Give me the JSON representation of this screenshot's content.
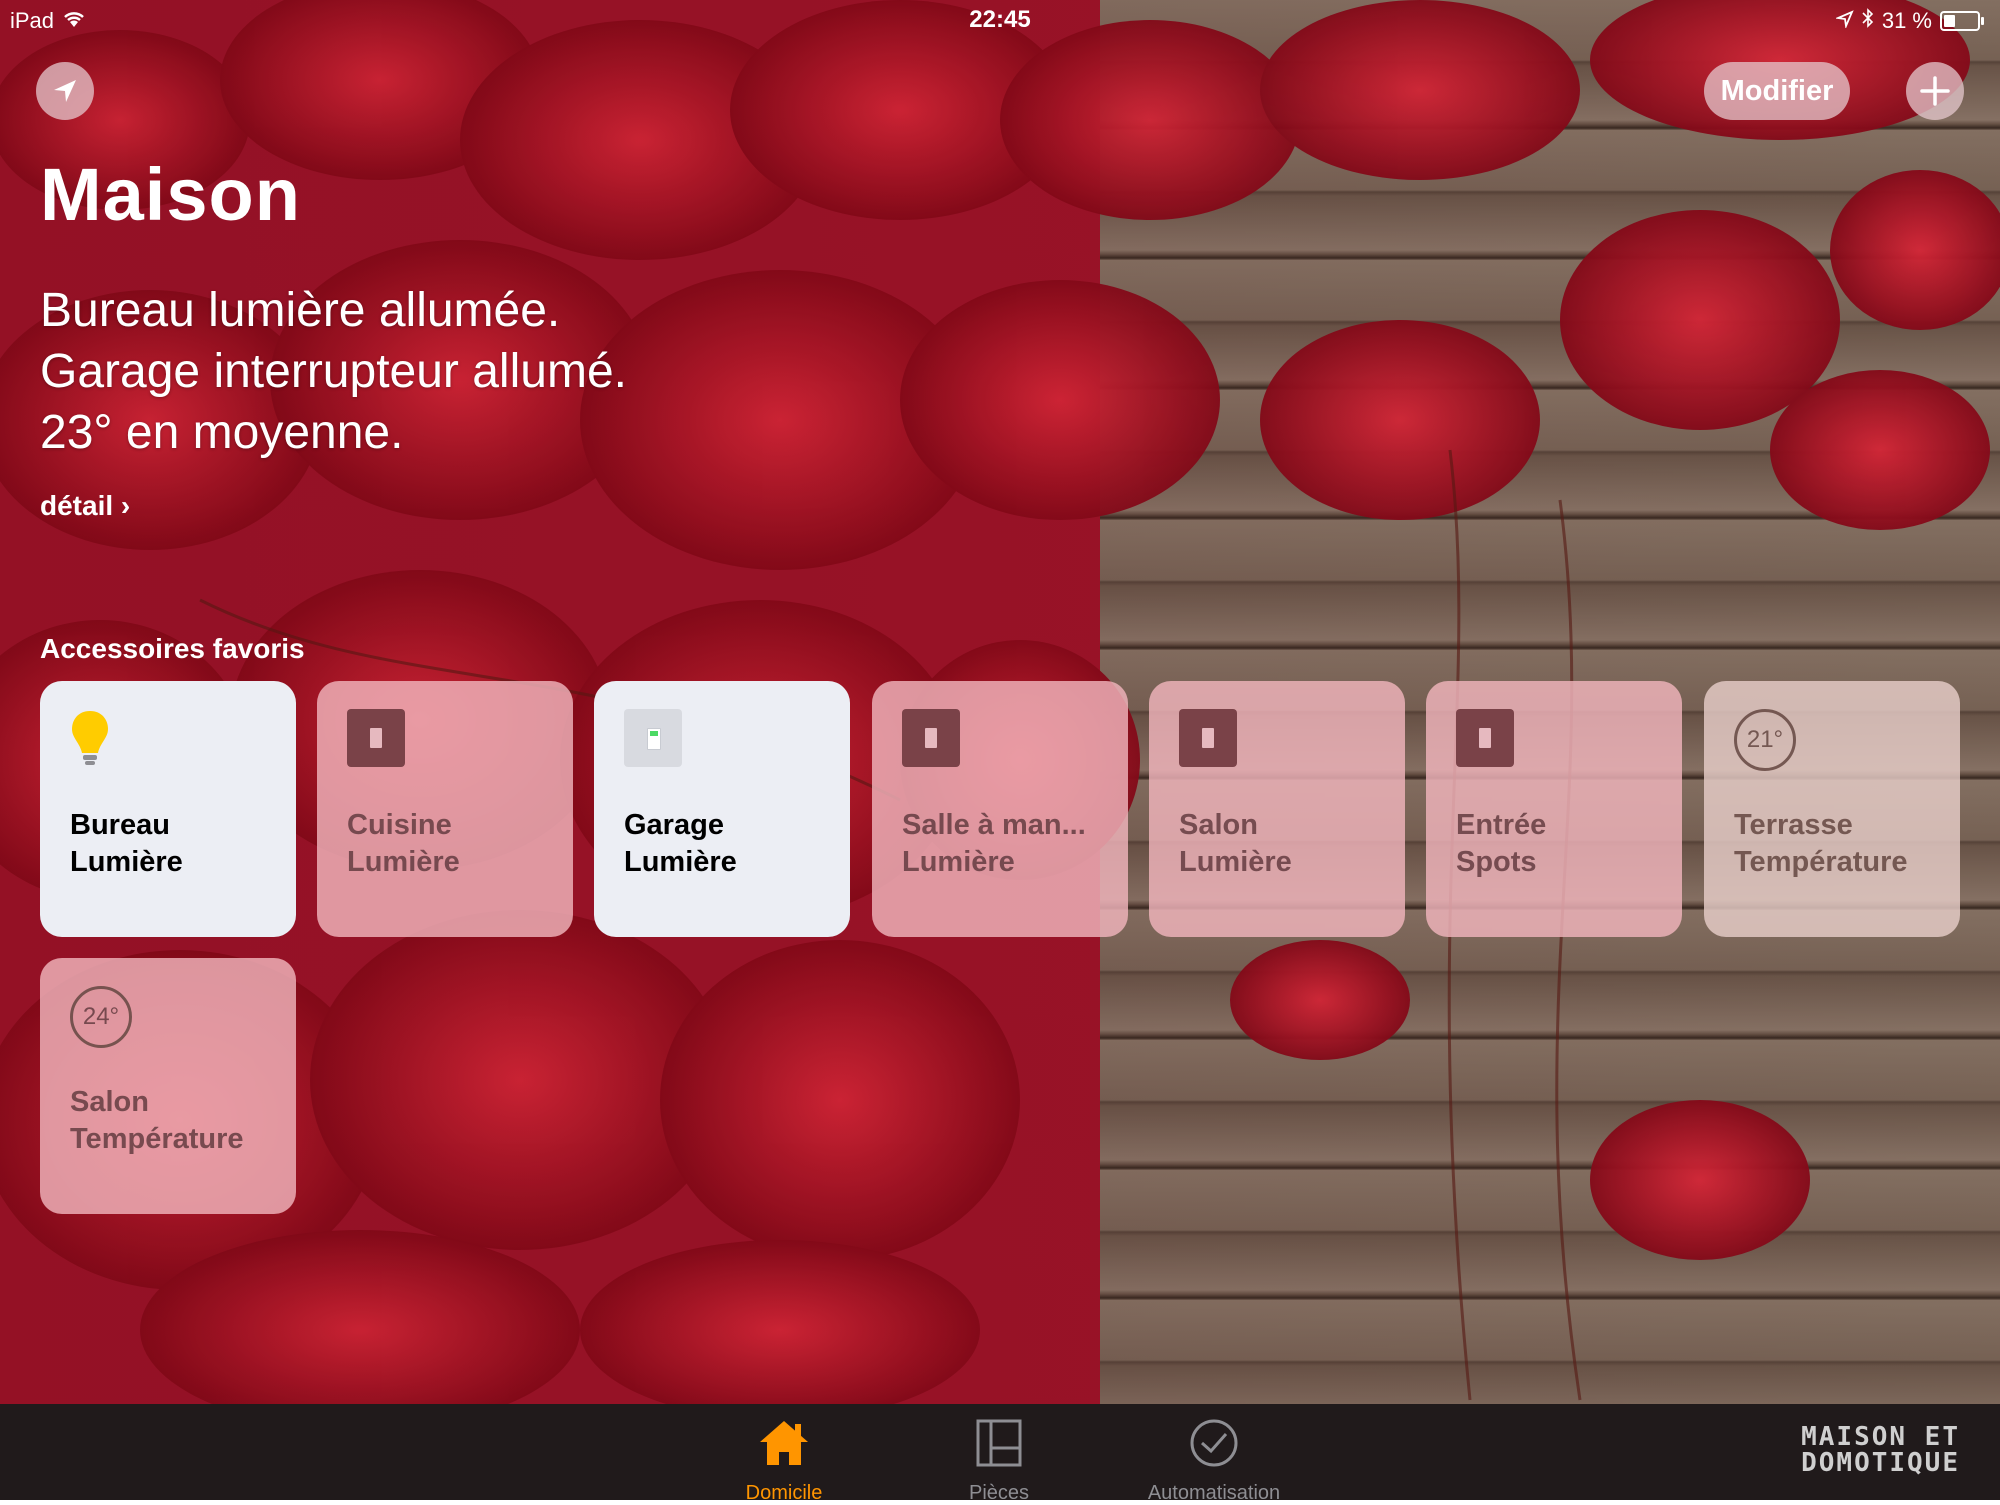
{
  "status_bar": {
    "device": "iPad",
    "time": "22:45",
    "battery": "31 %",
    "battery_level": 0.31
  },
  "header": {
    "edit_label": "Modifier",
    "title": "Maison"
  },
  "summary": {
    "lines": [
      "Bureau lumière allumée.",
      "Garage interrupteur allumé.",
      "23° en moyenne."
    ],
    "detail_link": "détail ›"
  },
  "favorites": {
    "section_title": "Accessoires favoris",
    "tiles": [
      {
        "line1": "Bureau",
        "line2": "Lumière",
        "state": "on",
        "icon": "lightbulb-icon"
      },
      {
        "line1": "Cuisine",
        "line2": "Lumière",
        "state": "off",
        "icon": "switch-icon"
      },
      {
        "line1": "Garage",
        "line2": "Lumière",
        "state": "on",
        "icon": "switch-icon"
      },
      {
        "line1": "Salle à man...",
        "line2": "Lumière",
        "state": "off",
        "icon": "switch-icon"
      },
      {
        "line1": "Salon",
        "line2": "Lumière",
        "state": "off",
        "icon": "switch-icon"
      },
      {
        "line1": "Entrée",
        "line2": "Spots",
        "state": "off",
        "icon": "switch-icon"
      },
      {
        "line1": "Terrasse",
        "line2": "Température",
        "state": "temp",
        "icon": "thermometer-icon",
        "value": "21°"
      },
      {
        "line1": "Salon",
        "line2": "Température",
        "state": "temp",
        "icon": "thermometer-icon",
        "value": "24°"
      }
    ]
  },
  "tabbar": {
    "tabs": [
      {
        "label": "Domicile",
        "icon": "house-icon",
        "active": true
      },
      {
        "label": "Pièces",
        "icon": "rooms-icon",
        "active": false
      },
      {
        "label": "Automatisation",
        "icon": "clock-icon",
        "active": false
      }
    ]
  },
  "watermark": {
    "line1": "MAISON ET",
    "line2": "DOMOTIQUE"
  },
  "colors": {
    "accent": "#ff9500",
    "tile_on": "#eceef4",
    "tile_off": "#f0b4bc",
    "tabbar": "#201a1b"
  }
}
